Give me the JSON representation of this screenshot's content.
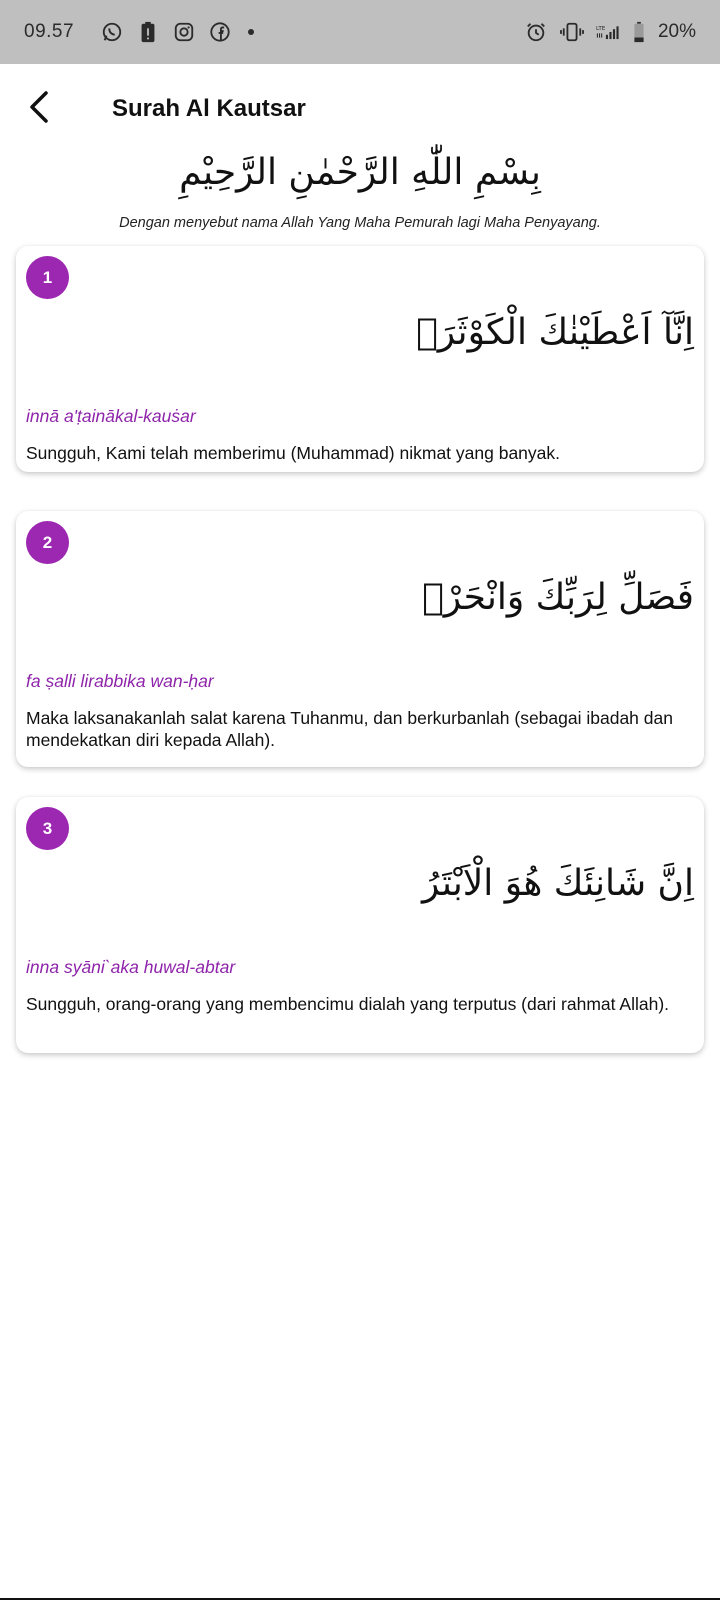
{
  "status_bar": {
    "time": "09.57",
    "left_icons": [
      "whatsapp-icon",
      "alert-icon",
      "instagram-icon",
      "facebook-icon"
    ],
    "right_icons": [
      "alarm-icon",
      "vibrate-icon",
      "lte-signal-icon",
      "battery-icon"
    ],
    "battery": "20%"
  },
  "app_bar": {
    "title": "Surah Al Kautsar"
  },
  "bismillah": {
    "arabic": "بِسْمِ اللّٰهِ الرَّحْمٰنِ الرَّحِيْمِ",
    "translation": "Dengan menyebut nama Allah Yang Maha Pemurah lagi Maha Penyayang."
  },
  "ayat": [
    {
      "number": "1",
      "arabic": "اِنَّآ اَعْطَيْنٰكَ الْكَوْثَرَۗ",
      "latin": "innā a'ṭainākal-kauṡar",
      "translation": "Sungguh, Kami telah memberimu (Muhammad) nikmat yang banyak."
    },
    {
      "number": "2",
      "arabic": "فَصَلِّ لِرَبِّكَ وَانْحَرْۗ",
      "latin": "fa ṣalli lirabbika wan-ḥar",
      "translation": "Maka laksanakanlah salat karena Tuhanmu, dan berkurbanlah (sebagai ibadah dan mendekatkan diri kepada Allah)."
    },
    {
      "number": "3",
      "arabic": "اِنَّ شَانِئَكَ هُوَ الْاَبْتَرُ",
      "latin": "inna syāni`aka huwal-abtar",
      "translation": "Sungguh, orang-orang yang membencimu dialah yang terputus (dari rahmat Allah)."
    }
  ],
  "colors": {
    "accent": "#9c27b0",
    "latin_text": "#8e24aa",
    "status_bar_bg": "#bfbfbf"
  }
}
